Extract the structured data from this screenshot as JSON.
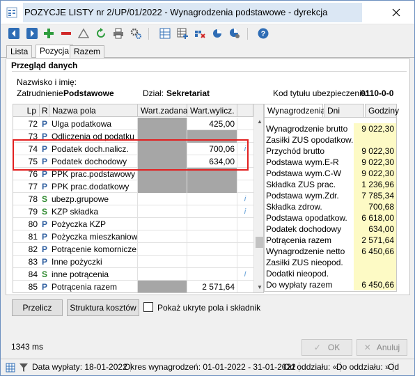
{
  "window": {
    "title": "POZYCJE LISTY nr 2/UP/01/2022 - Wynagrodzenia podstawowe - dyrekcja"
  },
  "tabs": [
    "Lista",
    "Pozycja",
    "Razem"
  ],
  "panel": {
    "title": "Przegląd danych",
    "name_label": "Nazwisko i imię:",
    "employment_label": "Zatrudnienie:",
    "employment_value": "Podstawowe",
    "department_label": "Dział:",
    "department_value": "Sekretariat",
    "insurance_label": "Kod tytułu ubezpieczenia:",
    "insurance_value": "0110-0-0"
  },
  "grid": {
    "headers": [
      "Lp",
      "R",
      "Nazwa pola",
      "Wart.zadana",
      "Wart.wylicz."
    ],
    "rows": [
      {
        "lp": "72",
        "r": "P",
        "name": "Ulga podatkowa",
        "value": "425,00",
        "info": ""
      },
      {
        "lp": "73",
        "r": "P",
        "name": "Odliczenia od podatku",
        "value": "",
        "info": ""
      },
      {
        "lp": "74",
        "r": "P",
        "name": "Podatek doch.nalicz.",
        "value": "700,06",
        "info": "i"
      },
      {
        "lp": "75",
        "r": "P",
        "name": "Podatek dochodowy",
        "value": "634,00",
        "info": ""
      },
      {
        "lp": "76",
        "r": "P",
        "name": "PPK prac.podstawowy",
        "value": "",
        "info": ""
      },
      {
        "lp": "77",
        "r": "P",
        "name": "PPK prac.dodatkowy",
        "value": "",
        "info": ""
      },
      {
        "lp": "78",
        "r": "S",
        "name": "ubezp.grupowe",
        "value": "",
        "info": "i"
      },
      {
        "lp": "79",
        "r": "S",
        "name": "KZP składka",
        "value": "",
        "info": "i"
      },
      {
        "lp": "80",
        "r": "P",
        "name": "Pożyczka KZP",
        "value": "",
        "info": ""
      },
      {
        "lp": "81",
        "r": "P",
        "name": "Pożyczka mieszkaniowa",
        "value": "",
        "info": ""
      },
      {
        "lp": "82",
        "r": "P",
        "name": "Potrącenie komornicze",
        "value": "",
        "info": ""
      },
      {
        "lp": "83",
        "r": "P",
        "name": "Inne pożyczki",
        "value": "",
        "info": ""
      },
      {
        "lp": "84",
        "r": "S",
        "name": "inne potrącenia",
        "value": "",
        "info": "i"
      },
      {
        "lp": "85",
        "r": "P",
        "name": "Potrącenia razem",
        "value": "2 571,64",
        "info": ""
      }
    ]
  },
  "right_tabs": [
    "Wynagrodzenia",
    "Dni pracy",
    "Godziny"
  ],
  "summary": [
    {
      "label": "Wynagrodzenie brutto",
      "value": "9 022,30"
    },
    {
      "label": "Zasiłki ZUS opodatkow.",
      "value": ""
    },
    {
      "label": "Przychód brutto",
      "value": "9 022,30"
    },
    {
      "label": "Podstawa wym.E-R",
      "value": "9 022,30"
    },
    {
      "label": "Podstawa wym.C-W",
      "value": "9 022,30"
    },
    {
      "label": "Składka ZUS prac.",
      "value": "1 236,96"
    },
    {
      "label": "Podstawa wym.Zdr.",
      "value": "7 785,34"
    },
    {
      "label": "Składka zdrow.",
      "value": "700,68"
    },
    {
      "label": "Podstawa opodatkow.",
      "value": "6 618,00"
    },
    {
      "label": "Podatek dochodowy",
      "value": "634,00"
    },
    {
      "label": "Potrącenia razem",
      "value": "2 571,64"
    },
    {
      "label": "Wynagrodzenie netto",
      "value": "6 450,66"
    },
    {
      "label": "Zasiłki ZUS nieopod.",
      "value": ""
    },
    {
      "label": "Dodatki nieopod.",
      "value": ""
    },
    {
      "label": "Do wypłaty razem",
      "value": "6 450,66"
    }
  ],
  "buttons": {
    "recalc": "Przelicz",
    "cost_structure": "Struktura kosztów",
    "show_hidden": "Pokaż ukryte pola i składnik",
    "ok": "OK",
    "cancel": "Anuluj"
  },
  "timing": "1343 ms",
  "statusbar": {
    "pay_date": "Data wypłaty: 18-01-2022",
    "period": "Okres wynagrodzeń: 01-01-2022 - 31-01-2022",
    "from_dept": "Od oddziału: «",
    "to_dept": "Do oddziału: »",
    "od": "Od"
  },
  "colors": {
    "accent_blue": "#2f6db5",
    "highlight_red": "#e22020",
    "value_yellow": "#fdfac5",
    "grey_cell": "#a6a6a6"
  }
}
